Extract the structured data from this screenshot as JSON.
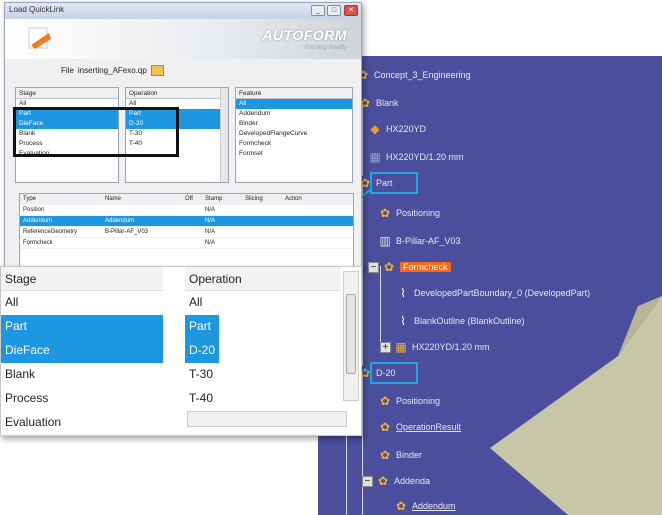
{
  "dialog": {
    "title": "Load QuickLink",
    "brand": "AUTOFORM",
    "brand_sub": "Forming Reality",
    "file_label": "File",
    "file_value": "inserting_AFexo.qp",
    "stage_header": "Stage",
    "operation_header": "Operation",
    "feature_header": "Feature",
    "stage_rows": [
      "All",
      "Part",
      "DieFace",
      "Blank",
      "Process",
      "Evaluation"
    ],
    "operation_rows": [
      "All",
      "Part",
      "D-20",
      "T-30",
      "T-40"
    ],
    "feature_rows": [
      "All",
      "Addendum",
      "Binder",
      "DevelopedFlangeCurve",
      "Formcheck",
      "Formset"
    ],
    "table_headers": [
      "Type",
      "Name",
      "Off",
      "Stamp",
      "Slicing",
      "Action"
    ],
    "table_rows": [
      [
        "Position",
        "",
        "",
        "N/A",
        "",
        ""
      ],
      [
        "Addendum",
        "Addendum",
        "",
        "N/A",
        "",
        ""
      ],
      [
        "ReferenceGeometry",
        "B-Pillar-AF_V03",
        "",
        "N/A",
        "",
        ""
      ],
      [
        "Formcheck",
        "",
        "",
        "N/A",
        "",
        ""
      ]
    ]
  },
  "zoom": {
    "stage_header": "Stage",
    "operation_header": "Operation",
    "stage_rows": [
      "All",
      "Part",
      "DieFace",
      "Blank",
      "Process",
      "Evaluation"
    ],
    "operation_rows": [
      "All",
      "Part",
      "D-20",
      "T-30",
      "T-40"
    ],
    "selected_stage": [
      "Part",
      "DieFace"
    ],
    "selected_operation": [
      "Part",
      "D-20"
    ]
  },
  "tree": {
    "root": "Concept_3_Engineering",
    "blank": "Blank",
    "hx220yd": "HX220YD",
    "hx220yd_thick": "HX220YD/1.20 mm",
    "part": "Part",
    "positioning": "Positioning",
    "bpillar": "B-Pillar-AF_V03",
    "formcheck": "Formcheck",
    "dev_boundary": "DevelopedPartBoundary_0 (DevelopedPart)",
    "blank_outline": "BlankOutline (BlankOutline)",
    "hx220yd_thick2": "HX220YD/1.20 mm",
    "d20": "D-20",
    "positioning2": "Positioning",
    "op_result": "OperationResult",
    "binder": "Binder",
    "addenda": "Addenda",
    "addendum": "Addendum"
  },
  "colors": {
    "tree_bg": "#4a4e9c",
    "selection": "#1c97e0",
    "highlight_box": "#1fa7e0",
    "formcheck_highlight": "#f26a1b"
  }
}
